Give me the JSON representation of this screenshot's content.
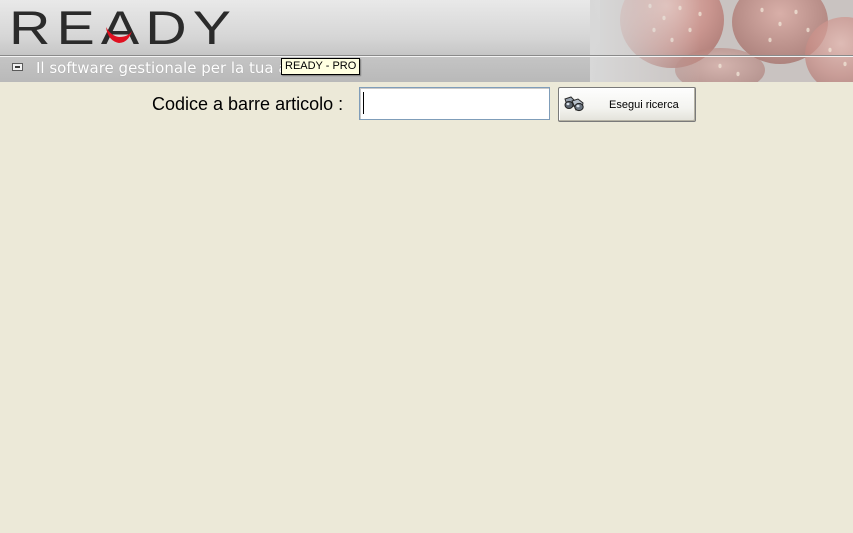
{
  "header": {
    "logo_text": "READY",
    "tagline": "Il software gestionale per la tua a",
    "tooltip": "READY - PRO"
  },
  "search": {
    "label": "Codice a barre articolo :",
    "value": "",
    "placeholder": "",
    "button_label": "Esegui ricerca",
    "button_icon": "binoculars-icon"
  },
  "colors": {
    "background": "#ece9d8",
    "logo_text": "#2b2b2b",
    "logo_accent": "#e01020",
    "tooltip_bg": "#ffffe1"
  }
}
